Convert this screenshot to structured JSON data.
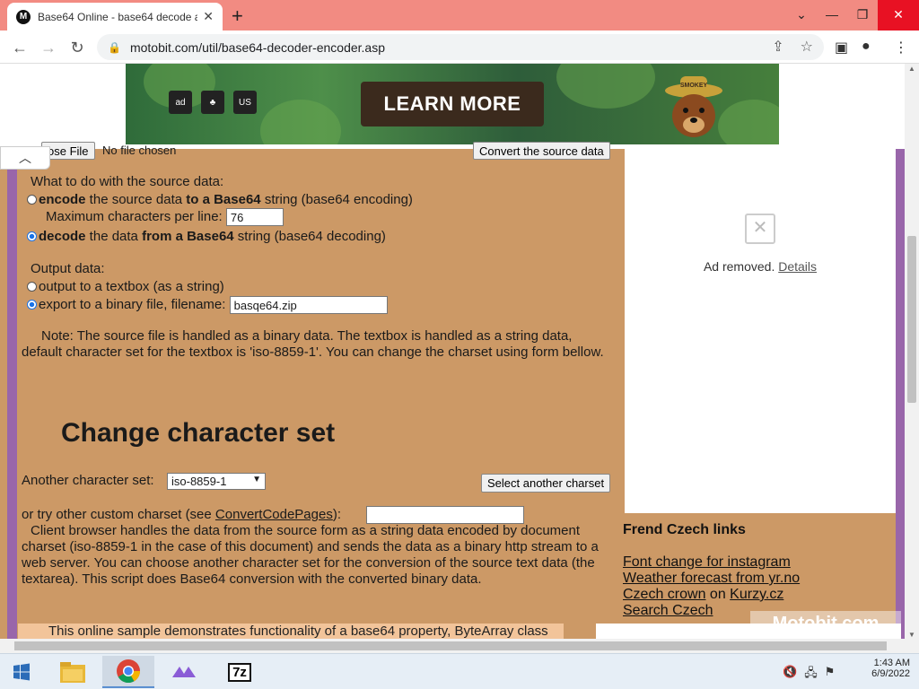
{
  "browser": {
    "tab_title": "Base64 Online - base64 decode a",
    "tab_favicon": "M",
    "new_tab": "+",
    "url": "motobit.com/util/base64-decoder-encoder.asp"
  },
  "ad_banner": {
    "cta": "LEARN MORE",
    "logo1": "ad",
    "logo2": "♣",
    "logo3": "US",
    "hat_text": "SMOKEY"
  },
  "form": {
    "file_button": "ose File",
    "file_status": "No file chosen",
    "convert_button": "Convert the source data",
    "what_to_do": "What to do with the source data:",
    "encode_bold1": "encode",
    "encode_text1": " the source data ",
    "encode_bold2": "to a Base64",
    "encode_text2": " string (base64 encoding)",
    "max_chars_label": "Maximum characters per line:",
    "max_chars_value": "76",
    "decode_bold1": "decode",
    "decode_text1": " the data ",
    "decode_bold2": "from a Base64",
    "decode_text2": " string (base64 decoding)",
    "output_label": "Output data:",
    "output_textbox": "output to a textbox (as a string)",
    "export_label": "export to a binary file, filename:",
    "export_value": "basqe64.zip",
    "note": "Note: The source file is handled as a binary data. The textbox is handled as a string data, default character set for the textbox is 'iso-8859-1'. You can change the charset using form bellow."
  },
  "charset": {
    "heading": "Change character set",
    "another_label": "Another character set:",
    "selected": "iso-8859-1",
    "select_button": "Select another charset",
    "custom_label": "or try other custom charset (see ",
    "custom_link": "ConvertCodePages",
    "custom_end": "):",
    "paragraph": "Client browser handles the data from the source form as a string data encoded by document charset (iso-8859-1 in the case of this document) and sends the data as a binary http stream to a web server. You can choose another character set for the conversion of the source text data (the textarea). This script does Base64 conversion with the converted binary data.",
    "sample_line": "This online sample demonstrates functionality of a base64 property, ByteArray class"
  },
  "sidebar": {
    "ad_removed": "Ad removed.",
    "details": "Details",
    "links_title": "Frend Czech links",
    "link1": "Font change for instagram",
    "link2": "Weather forecast from yr.no",
    "link3a": "Czech crown",
    "link3b": " on ",
    "link3c": "Kurzy.cz",
    "link4": "Search Czech",
    "watermark": "Motobit.com"
  },
  "taskbar": {
    "time": "1:43 AM",
    "date": "6/9/2022",
    "sevenzip": "7z"
  }
}
